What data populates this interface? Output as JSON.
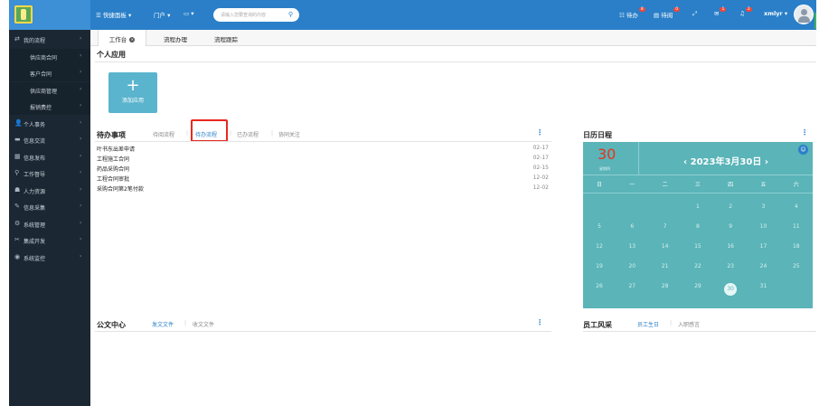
{
  "topbar": {
    "quick_nav": "快捷面板",
    "portal": "门户",
    "screen": "",
    "search_placeholder": "请输入您要查询的内容",
    "todo": "待办",
    "todo_count": "8",
    "read": "待阅",
    "read_count": "0",
    "msg_count": "1",
    "bell_count": "2",
    "user": "xmlyr"
  },
  "sidebar": {
    "items": [
      {
        "label": "我的流程",
        "icon": "⇄",
        "sub": false
      },
      {
        "label": "供应商合同",
        "icon": "",
        "sub": true
      },
      {
        "label": "客户合同",
        "icon": "",
        "sub": true
      },
      {
        "label": "供应商管理",
        "icon": "",
        "sub": true
      },
      {
        "label": "报销费控",
        "icon": "",
        "sub": true
      },
      {
        "label": "个人事务",
        "icon": "👤",
        "sub": false
      },
      {
        "label": "信息交流",
        "icon": "▬",
        "sub": false
      },
      {
        "label": "信息发布",
        "icon": "▦",
        "sub": false
      },
      {
        "label": "工作督导",
        "icon": "⚲",
        "sub": false
      },
      {
        "label": "人力资源",
        "icon": "☗",
        "sub": false
      },
      {
        "label": "信息采集",
        "icon": "✎",
        "sub": false
      },
      {
        "label": "系统管理",
        "icon": "⚙",
        "sub": false
      },
      {
        "label": "集成开发",
        "icon": "✂",
        "sub": false
      },
      {
        "label": "系统监控",
        "icon": "◉",
        "sub": false
      }
    ]
  },
  "tabs": [
    {
      "label": "工作台",
      "closable": true
    },
    {
      "label": "流程办理",
      "closable": false
    },
    {
      "label": "流程跟踪",
      "closable": false
    }
  ],
  "personal_apps": {
    "title": "个人应用",
    "add_label": "添加应用"
  },
  "todo": {
    "title": "待办事项",
    "subtabs": [
      "待阅流程",
      "待办流程",
      "已办流程",
      "协同关注"
    ],
    "rows": [
      {
        "title": "叶书东出差申请",
        "date": "02-17"
      },
      {
        "title": "工程施工合同",
        "date": "02-17"
      },
      {
        "title": "药品采购合同",
        "date": "02-15"
      },
      {
        "title": "工程合同审批",
        "date": "12-02"
      },
      {
        "title": "采购合同第2笔付款",
        "date": "12-02"
      }
    ]
  },
  "calendar": {
    "title": "日历日程",
    "today_num": "30",
    "today_weekday": "星期四",
    "month_label": "2023年3月30日",
    "weekdays": [
      "日",
      "一",
      "二",
      "三",
      "四",
      "五",
      "六"
    ],
    "weeks": [
      [
        "",
        "",
        "",
        "1",
        "2",
        "3",
        "4"
      ],
      [
        "5",
        "6",
        "7",
        "8",
        "9",
        "10",
        "11"
      ],
      [
        "12",
        "13",
        "14",
        "15",
        "16",
        "17",
        "18"
      ],
      [
        "19",
        "20",
        "21",
        "22",
        "23",
        "24",
        "25"
      ],
      [
        "26",
        "27",
        "28",
        "29",
        "30",
        "31",
        ""
      ]
    ],
    "selected": "30"
  },
  "documents": {
    "title": "公文中心",
    "subtabs": [
      "发文文件",
      "收文文件"
    ]
  },
  "staff": {
    "title": "员工风采",
    "subtabs": [
      "员工生日",
      "入职感言"
    ]
  },
  "colors": {
    "topbar": "#2a7fc8",
    "sidebar": "#1b2833",
    "calendar": "#5ab4b8",
    "highlight": "#e8281e"
  }
}
